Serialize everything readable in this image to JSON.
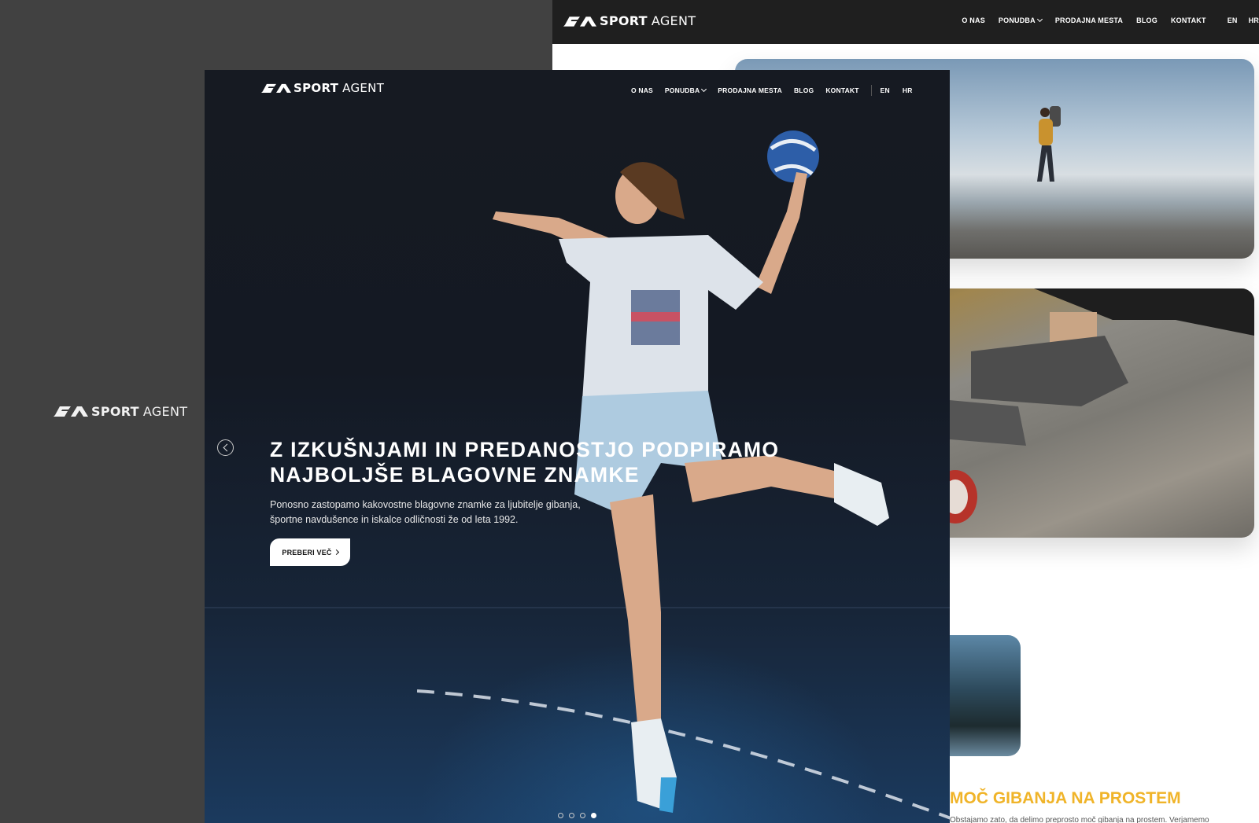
{
  "brand": {
    "bold": "SPORT",
    "light": "AGENT"
  },
  "back_window": {
    "nav": {
      "items": [
        "O NAS",
        "PONUDBA",
        "PRODAJNA MESTA",
        "BLOG",
        "KONTAKT"
      ],
      "languages": [
        "EN",
        "HR"
      ]
    },
    "section_heading": "MOČ GIBANJA NA PROSTEM",
    "section_text": "Obstajamo zato, da delimo preprosto moč gibanja na prostem. Verjamemo",
    "social_icons": [
      "facebook-icon",
      "instagram-icon",
      "globe-icon"
    ],
    "accent_color": "#f0b429"
  },
  "hero": {
    "nav": {
      "items": [
        "O NAS",
        "PONUDBA",
        "PRODAJNA MESTA",
        "BLOG",
        "KONTAKT"
      ],
      "languages": [
        "EN",
        "HR"
      ]
    },
    "heading_line1": "Z IZKUŠNJAMI IN PREDANOSTJO PODPIRAMO",
    "heading_line2": "NAJBOLJŠE BLAGOVNE ZNAMKE",
    "sub_line1": "Ponosno zastopamo kakovostne blagovne znamke za ljubitelje gibanja,",
    "sub_line2": "športne navdušence in iskalce odličnosti že od leta 1992.",
    "button_label": "PREBERI VEČ",
    "slides_total": 4,
    "slide_active": 4
  }
}
